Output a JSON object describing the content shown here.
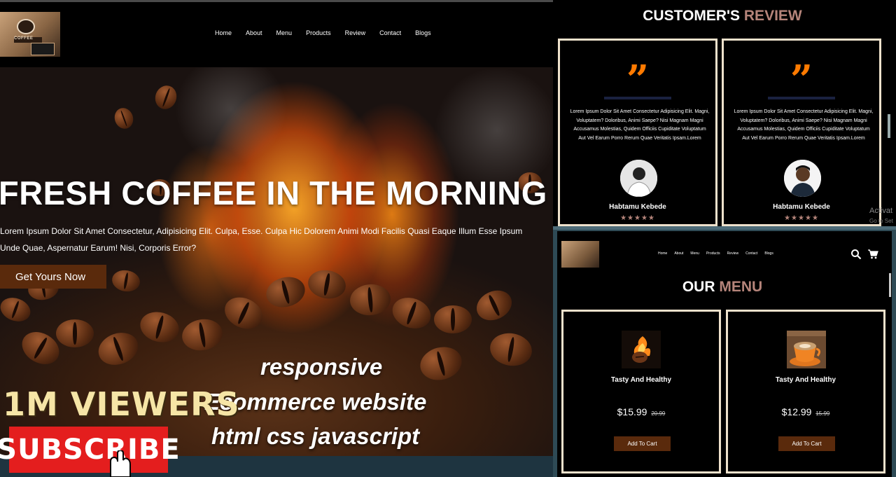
{
  "left": {
    "nav": {
      "logo_text": "COFFEE",
      "links": [
        "Home",
        "About",
        "Menu",
        "Products",
        "Review",
        "Contact",
        "Blogs"
      ]
    },
    "hero": {
      "title": "FRESH COFFEE IN THE MORNING",
      "desc_line1": "Lorem Ipsum Dolor Sit Amet Consectetur, Adipisicing Elit. Culpa, Esse. Culpa Hic Dolorem Animi Modi Facilis Quasi Eaque Illum Esse Ipsum",
      "desc_line2": "Unde Quae, Aspernatur Earum! Nisi, Corporis Error?",
      "button": "Get Yours Now"
    },
    "promo": {
      "line1": "responsive",
      "line2": "Ecommerce website",
      "line3": "html css javascript",
      "viewers": "1M VIEWERS",
      "subscribe": "SUBSCRIBE"
    }
  },
  "reviews": {
    "title_main": "CUSTOMER'S",
    "title_accent": "REVIEW",
    "cards": [
      {
        "text": "Lorem Ipsum Dolor Sit Amet Consectetur Adipisicing Elit. Magni, Voluptatem? Doloribus, Animi Saepe? Nisi Magnam Magni Accusamus Molestias, Quidem Officiis Cupiditate Voluptatum Aut Vel Earum Porro Rerum Quae Veritatis Ipsam.Lorem",
        "name": "Habtamu Kebede",
        "stars": "★★★★★"
      },
      {
        "text": "Lorem Ipsum Dolor Sit Amet Consectetur Adipisicing Elit. Magni, Voluptatem? Doloribus, Animi Saepe? Nisi Magnam Magni Accusamus Molestias, Quidem Officiis Cupiditate Voluptatum Aut Vel Earum Porro Rerum Quae Veritatis Ipsam.Lorem",
        "name": "Habtamu Kebede",
        "stars": "★★★★★"
      }
    ],
    "overlay_line1": "Activat",
    "overlay_line2": "Go to Set"
  },
  "menu": {
    "nav_links": [
      "Home",
      "About",
      "Menu",
      "Products",
      "Review",
      "Contact",
      "Blogs"
    ],
    "title_main": "OUR",
    "title_accent": "MENU",
    "items": [
      {
        "name": "Tasty And Healthy",
        "price": "$15.99",
        "old_price": "20.99",
        "button": "Add To Cart"
      },
      {
        "name": "Tasty And Healthy",
        "price": "$12.99",
        "old_price": "15.99",
        "button": "Add To Cart"
      }
    ]
  },
  "colors": {
    "accent": "#b5847a",
    "button": "#5a2a0c",
    "quote": "#ff7a00",
    "card_border": "#efe2cc",
    "subscribe": "#e41e1e"
  }
}
